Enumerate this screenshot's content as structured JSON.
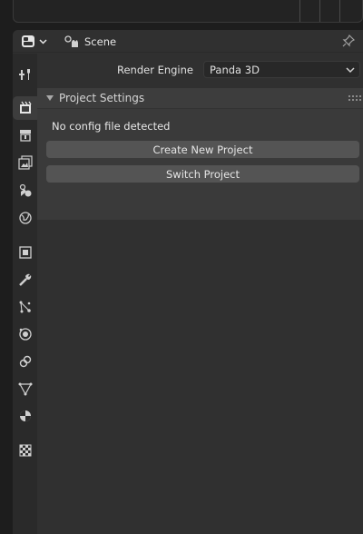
{
  "header": {
    "scene_name": "Scene"
  },
  "render": {
    "label": "Render Engine",
    "value": "Panda 3D"
  },
  "panel": {
    "title": "Project Settings",
    "info": "No config file detected",
    "buttons": [
      "Create New Project",
      "Switch Project"
    ]
  },
  "tabs": [
    "tool-icon",
    "render-icon",
    "output-icon",
    "view-layer-icon",
    "scene-icon",
    "world-icon",
    "object-icon",
    "modifier-icon",
    "particles-icon",
    "physics-icon",
    "constraints-icon",
    "object-data-icon",
    "material-icon",
    "texture-icon"
  ],
  "colors": {
    "background": "#303030",
    "panel": "#3a3a3a",
    "button": "#545454",
    "tabbar": "#2a2a2a",
    "active_tab": "#3d3d3d"
  }
}
